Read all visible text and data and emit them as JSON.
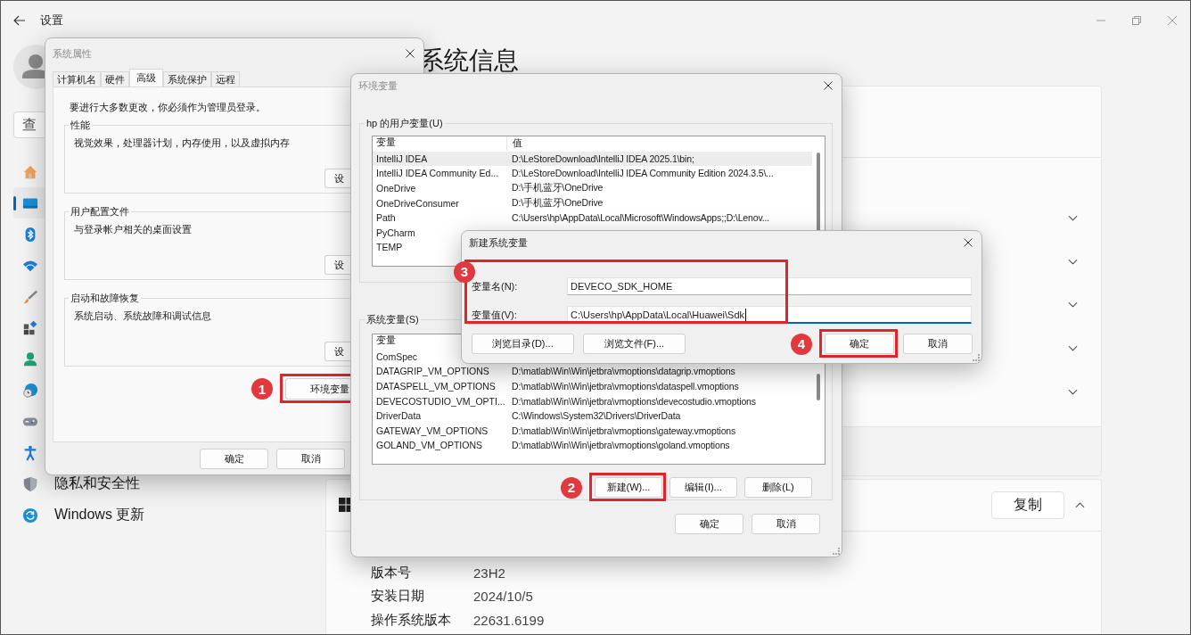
{
  "settings": {
    "title": "设置",
    "search_placeholder": "查",
    "nav": [
      {
        "kind": "home",
        "selected": false
      },
      {
        "kind": "system",
        "selected": true
      },
      {
        "kind": "bluetooth",
        "selected": false
      },
      {
        "kind": "network",
        "selected": false
      },
      {
        "kind": "personalization",
        "selected": false
      },
      {
        "kind": "apps",
        "selected": false
      },
      {
        "kind": "accounts",
        "selected": false
      },
      {
        "kind": "time",
        "selected": false
      },
      {
        "kind": "gaming",
        "selected": false
      },
      {
        "kind": "accessibility",
        "selected": false
      },
      {
        "kind": "privacy",
        "label": "隐私和安全性",
        "selected": false
      },
      {
        "kind": "update",
        "label": "Windows 更新",
        "selected": false
      }
    ],
    "page_title": "系统信息",
    "device_rows": [
      {
        "expanded": false
      },
      {
        "expanded": false
      },
      {
        "expanded": false
      },
      {
        "expanded": false
      },
      {
        "expanded": false
      }
    ],
    "spec_section": {
      "copy_button": "复制",
      "expanded": true,
      "rows": [
        {
          "label": "版本号",
          "value": "23H2"
        },
        {
          "label": "安装日期",
          "value": "2024/10/5"
        },
        {
          "label": "操作系统版本",
          "value": "22631.6199"
        }
      ]
    }
  },
  "system_properties": {
    "title": "系统属性",
    "tabs": [
      {
        "label": "计算机名",
        "selected": false
      },
      {
        "label": "硬件",
        "selected": false
      },
      {
        "label": "高级",
        "selected": true
      },
      {
        "label": "系统保护",
        "selected": false
      },
      {
        "label": "远程",
        "selected": false
      }
    ],
    "notice": "要进行大多数更改，你必须作为管理员登录。",
    "groups": [
      {
        "title": "性能",
        "description": "视觉效果，处理器计划，内存使用，以及虚拟内存",
        "button": "设"
      },
      {
        "title": "用户配置文件",
        "description": "与登录帐户相关的桌面设置",
        "button": "设"
      },
      {
        "title": "启动和故障恢复",
        "description": "系统启动、系统故障和调试信息",
        "button": "设"
      }
    ],
    "env_button": {
      "label": "环境变量",
      "callout": "1"
    },
    "buttons": [
      "确定",
      "取消"
    ]
  },
  "environment_variables": {
    "title": "环境变量",
    "user_variables": {
      "title": "hp 的用户变量(U)",
      "columns": [
        "变量",
        "值"
      ],
      "rows": [
        {
          "name": "IntelliJ IDEA",
          "value": "D:\\LeStoreDownload\\IntelliJ IDEA 2025.1\\bin;",
          "selected": true
        },
        {
          "name": "IntelliJ IDEA Community Ed...",
          "value": "D:\\LeStoreDownload\\IntelliJ IDEA Community Edition 2024.3.5\\...",
          "selected": false
        },
        {
          "name": "OneDrive",
          "value": "D:\\手机蓝牙\\OneDrive",
          "selected": false
        },
        {
          "name": "OneDriveConsumer",
          "value": "D:\\手机蓝牙\\OneDrive",
          "selected": false
        },
        {
          "name": "Path",
          "value": "C:\\Users\\hp\\AppData\\Local\\Microsoft\\WindowsApps;;D:\\Lenov...",
          "selected": false
        },
        {
          "name": "PyCharm",
          "selected": false
        },
        {
          "name": "TEMP",
          "selected": false
        }
      ]
    },
    "system_variables": {
      "title": "系统变量(S)",
      "columns": [
        "变量"
      ],
      "rows": [
        {
          "name": "ComSpec",
          "selected": false
        },
        {
          "name": "DATAGRIP_VM_OPTIONS",
          "value": "D:\\matlab\\Win\\Win\\jetbra\\vmoptions\\datagrip.vmoptions",
          "selected": false
        },
        {
          "name": "DATASPELL_VM_OPTIONS",
          "value": "D:\\matlab\\Win\\Win\\jetbra\\vmoptions\\dataspell.vmoptions",
          "selected": false
        },
        {
          "name": "DEVECOSTUDIO_VM_OPTI...",
          "value": "D:\\matlab\\Win\\Win\\jetbra\\vmoptions\\devecostudio.vmoptions",
          "selected": false
        },
        {
          "name": "DriverData",
          "value": "C:\\Windows\\System32\\Drivers\\DriverData",
          "selected": false
        },
        {
          "name": "GATEWAY_VM_OPTIONS",
          "value": "D:\\matlab\\Win\\Win\\jetbra\\vmoptions\\gateway.vmoptions",
          "selected": false
        },
        {
          "name": "GOLAND_VM_OPTIONS",
          "value": "D:\\matlab\\Win\\Win\\jetbra\\vmoptions\\goland.vmoptions",
          "selected": false
        }
      ],
      "buttons": [
        {
          "label": "新建(W)...",
          "callout": "2"
        },
        {
          "label": "编辑(I)..."
        },
        {
          "label": "删除(L)"
        }
      ]
    },
    "buttons": [
      "确定",
      "取消"
    ]
  },
  "new_variable": {
    "title": "新建系统变量",
    "callout": "3",
    "fields": [
      {
        "label": "变量名(N):",
        "value": "DEVECO_SDK_HOME",
        "focused": false
      },
      {
        "label": "变量值(V):",
        "value": "C:\\Users\\hp\\AppData\\Local\\Huawei\\Sdk",
        "focused": true
      }
    ],
    "browse_buttons": [
      "浏览目录(D)...",
      "浏览文件(F)..."
    ],
    "buttons": [
      {
        "label": "确定",
        "callout": "4"
      },
      {
        "label": "取消"
      }
    ]
  }
}
